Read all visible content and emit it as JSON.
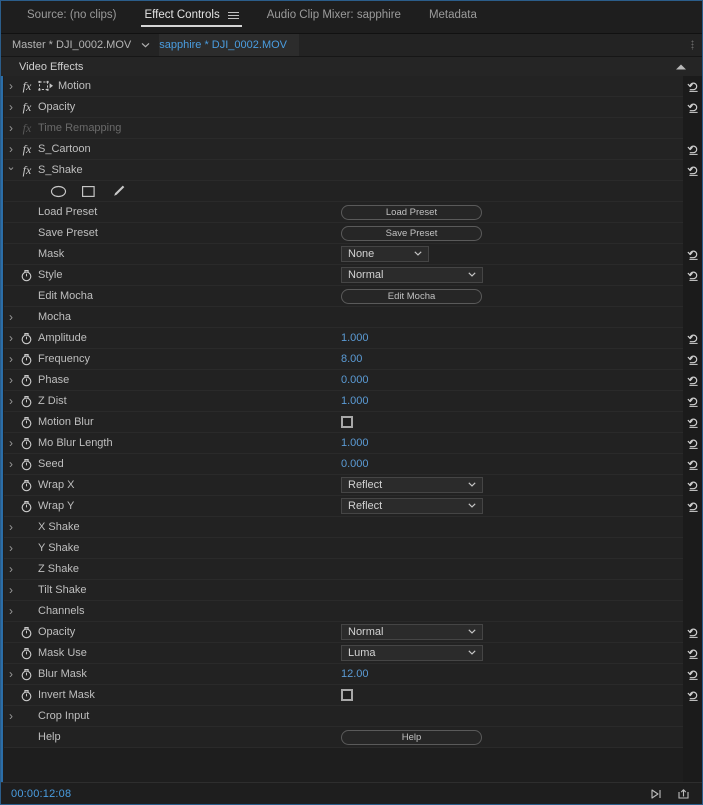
{
  "tabs": [
    {
      "label": "Source: (no clips)",
      "active": false,
      "menu": false
    },
    {
      "label": "Effect Controls",
      "active": true,
      "menu": true
    },
    {
      "label": "Audio Clip Mixer: sapphire",
      "active": false,
      "menu": false
    },
    {
      "label": "Metadata",
      "active": false,
      "menu": false
    }
  ],
  "clipbar": {
    "master": "Master * DJI_0002.MOV",
    "caret": "chevron-down-icon",
    "selected": "sapphire * DJI_0002.MOV"
  },
  "section": {
    "title": "Video Effects"
  },
  "effects": [
    {
      "name": "Motion",
      "kind": "effect",
      "open": false,
      "fx": true,
      "dim": false,
      "icon": "motion-icon",
      "reset": true
    },
    {
      "name": "Opacity",
      "kind": "effect",
      "open": false,
      "fx": true,
      "dim": false,
      "reset": true
    },
    {
      "name": "Time Remapping",
      "kind": "effect",
      "open": false,
      "fx": true,
      "dim": true,
      "reset": false
    },
    {
      "name": "S_Cartoon",
      "kind": "effect",
      "open": false,
      "fx": true,
      "dim": false,
      "reset": true
    },
    {
      "name": "S_Shake",
      "kind": "effect",
      "open": true,
      "fx": true,
      "dim": false,
      "reset": true
    }
  ],
  "shape_tools": [
    {
      "name": "ellipse-mask-tool"
    },
    {
      "name": "rectangle-mask-tool"
    },
    {
      "name": "pen-mask-tool"
    }
  ],
  "params": [
    {
      "label": "Load Preset",
      "type": "button",
      "value": "Load Preset",
      "stopwatch": false,
      "arrow": false,
      "reset": false
    },
    {
      "label": "Save Preset",
      "type": "button",
      "value": "Save Preset",
      "stopwatch": false,
      "arrow": false,
      "reset": false
    },
    {
      "label": "Mask",
      "type": "select-sm",
      "value": "None",
      "stopwatch": false,
      "arrow": false,
      "reset": true
    },
    {
      "label": "Style",
      "type": "select-lg",
      "value": "Normal",
      "stopwatch": true,
      "arrow": false,
      "reset": true
    },
    {
      "label": "Edit Mocha",
      "type": "button",
      "value": "Edit Mocha",
      "stopwatch": false,
      "arrow": false,
      "reset": false
    },
    {
      "label": "Mocha",
      "type": "group",
      "value": "",
      "stopwatch": false,
      "arrow": true,
      "reset": false
    },
    {
      "label": "Amplitude",
      "type": "number",
      "value": "1.000",
      "stopwatch": true,
      "arrow": true,
      "reset": true
    },
    {
      "label": "Frequency",
      "type": "number",
      "value": "8.00",
      "stopwatch": true,
      "arrow": true,
      "reset": true
    },
    {
      "label": "Phase",
      "type": "number",
      "value": "0.000",
      "stopwatch": true,
      "arrow": true,
      "reset": true
    },
    {
      "label": "Z Dist",
      "type": "number",
      "value": "1.000",
      "stopwatch": true,
      "arrow": true,
      "reset": true
    },
    {
      "label": "Motion Blur",
      "type": "checkbox",
      "value": "unchecked",
      "stopwatch": true,
      "arrow": false,
      "reset": true
    },
    {
      "label": "Mo Blur Length",
      "type": "number",
      "value": "1.000",
      "stopwatch": true,
      "arrow": true,
      "reset": true
    },
    {
      "label": "Seed",
      "type": "number",
      "value": "0.000",
      "stopwatch": true,
      "arrow": true,
      "reset": true
    },
    {
      "label": "Wrap X",
      "type": "select-lg",
      "value": "Reflect",
      "stopwatch": true,
      "arrow": false,
      "reset": true
    },
    {
      "label": "Wrap Y",
      "type": "select-lg",
      "value": "Reflect",
      "stopwatch": true,
      "arrow": false,
      "reset": true
    },
    {
      "label": "X Shake",
      "type": "group",
      "value": "",
      "stopwatch": false,
      "arrow": true,
      "reset": false
    },
    {
      "label": "Y Shake",
      "type": "group",
      "value": "",
      "stopwatch": false,
      "arrow": true,
      "reset": false
    },
    {
      "label": "Z Shake",
      "type": "group",
      "value": "",
      "stopwatch": false,
      "arrow": true,
      "reset": false
    },
    {
      "label": "Tilt Shake",
      "type": "group",
      "value": "",
      "stopwatch": false,
      "arrow": true,
      "reset": false
    },
    {
      "label": "Channels",
      "type": "group",
      "value": "",
      "stopwatch": false,
      "arrow": true,
      "reset": false
    },
    {
      "label": "Opacity",
      "type": "select-lg",
      "value": "Normal",
      "stopwatch": true,
      "arrow": false,
      "reset": true
    },
    {
      "label": "Mask Use",
      "type": "select-lg",
      "value": "Luma",
      "stopwatch": true,
      "arrow": false,
      "reset": true
    },
    {
      "label": "Blur Mask",
      "type": "number",
      "value": "12.00",
      "stopwatch": true,
      "arrow": true,
      "reset": true
    },
    {
      "label": "Invert Mask",
      "type": "checkbox",
      "value": "unchecked",
      "stopwatch": true,
      "arrow": false,
      "reset": true
    },
    {
      "label": "Crop Input",
      "type": "group",
      "value": "",
      "stopwatch": false,
      "arrow": true,
      "reset": false
    },
    {
      "label": "Help",
      "type": "button",
      "value": "Help",
      "stopwatch": false,
      "arrow": false,
      "reset": false
    }
  ],
  "footer": {
    "timecode": "00:00:12:08",
    "icons": [
      {
        "name": "play-only-audio-icon"
      },
      {
        "name": "export-frame-icon"
      }
    ]
  },
  "colors": {
    "accent_blue": "#4a9de0",
    "value_blue": "#5b9bd5",
    "panel_bg": "#1e1e1e",
    "row_bg": "#222222",
    "border": "#2a2a2a",
    "text": "#bfbfbf",
    "text_dim": "#6a6a6a"
  }
}
